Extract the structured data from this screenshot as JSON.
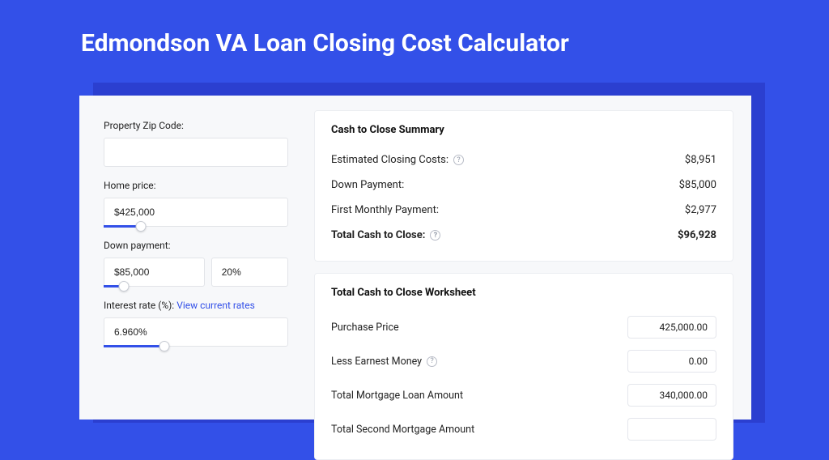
{
  "title": "Edmondson VA Loan Closing Cost Calculator",
  "form": {
    "zip_label": "Property Zip Code:",
    "zip_value": "",
    "home_price_label": "Home price:",
    "home_price_value": "$425,000",
    "home_price_slider_pct": 20,
    "down_payment_label": "Down payment:",
    "down_payment_value": "$85,000",
    "down_payment_pct_value": "20%",
    "down_payment_slider_pct": 20,
    "interest_label_prefix": "Interest rate (%): ",
    "interest_link_text": "View current rates",
    "interest_value": "6.960%",
    "interest_slider_pct": 33
  },
  "summary": {
    "heading": "Cash to Close Summary",
    "rows": [
      {
        "label": "Estimated Closing Costs:",
        "value": "$8,951",
        "help": true
      },
      {
        "label": "Down Payment:",
        "value": "$85,000",
        "help": false
      },
      {
        "label": "First Monthly Payment:",
        "value": "$2,977",
        "help": false
      }
    ],
    "total_label": "Total Cash to Close:",
    "total_value": "$96,928"
  },
  "worksheet": {
    "heading": "Total Cash to Close Worksheet",
    "rows": [
      {
        "label": "Purchase Price",
        "value": "425,000.00",
        "help": false
      },
      {
        "label": "Less Earnest Money",
        "value": "0.00",
        "help": true
      },
      {
        "label": "Total Mortgage Loan Amount",
        "value": "340,000.00",
        "help": false
      },
      {
        "label": "Total Second Mortgage Amount",
        "value": "",
        "help": false
      }
    ]
  }
}
